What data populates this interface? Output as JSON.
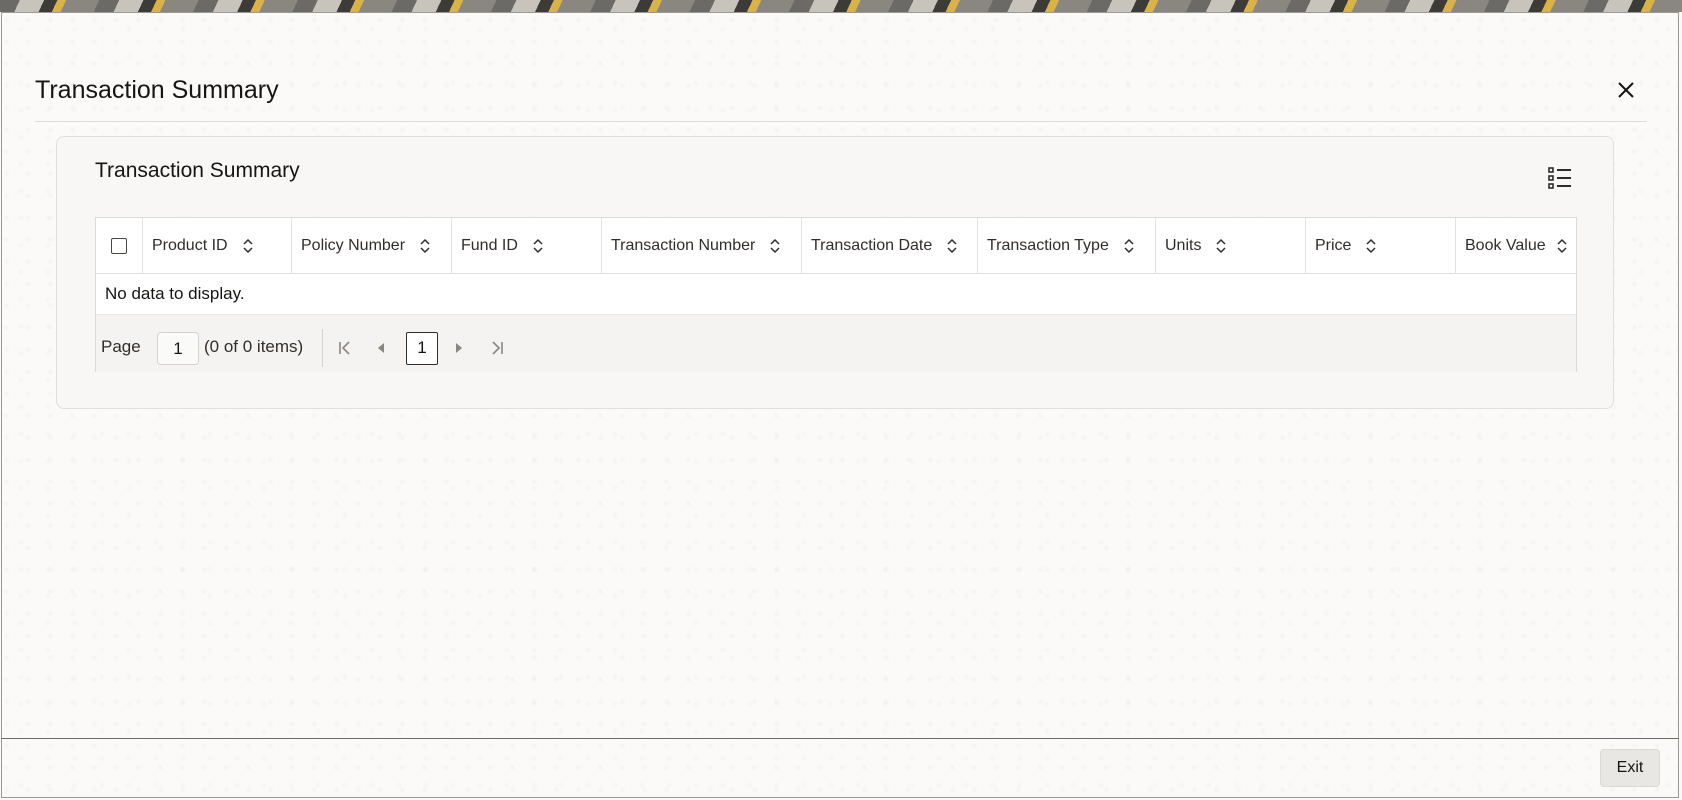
{
  "dialog": {
    "title": "Transaction Summary"
  },
  "panel": {
    "title": "Transaction Summary"
  },
  "table": {
    "columns": [
      "Product ID",
      "Policy Number",
      "Fund ID",
      "Transaction Number",
      "Transaction Date",
      "Transaction Type",
      "Units",
      "Price",
      "Book Value"
    ],
    "empty_message": "No data to display."
  },
  "pagination": {
    "page_label": "Page",
    "page_value": "1",
    "items_info": "(0 of 0 items)",
    "current_page": "1"
  },
  "footer": {
    "exit_label": "Exit"
  },
  "icons": {
    "close": "close-icon",
    "column_manager": "list-view-icon",
    "sort": "sort-icon",
    "first": "first-page-icon",
    "prev": "previous-page-icon",
    "next": "next-page-icon",
    "last": "last-page-icon"
  }
}
